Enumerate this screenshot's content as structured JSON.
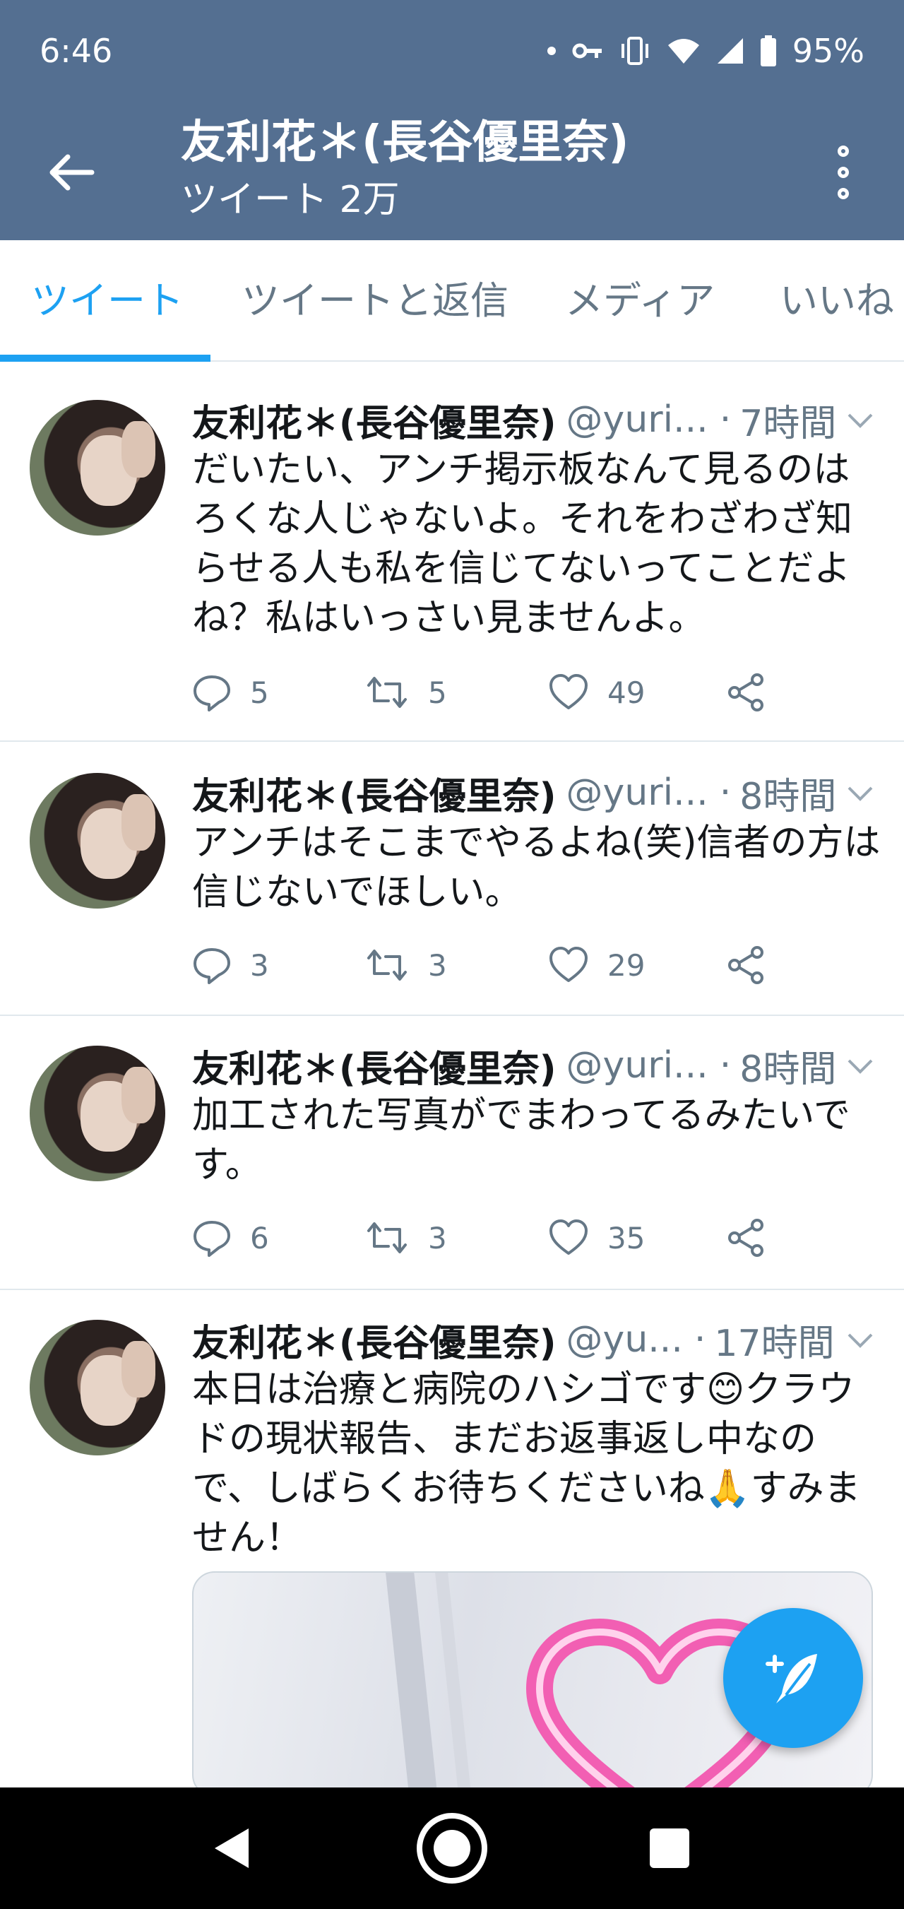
{
  "status_bar": {
    "time": "6:46",
    "battery": "95%",
    "icons": [
      "notification-dot-icon",
      "key-icon",
      "vibrate-icon",
      "wifi-icon",
      "signal-icon",
      "battery-icon"
    ]
  },
  "header": {
    "title": "友利花＊(長谷優里奈)",
    "subtitle": "ツイート 2万",
    "back_icon": "back-arrow-icon",
    "more_icon": "more-vertical-icon"
  },
  "tabs": [
    {
      "label": "ツイート",
      "active": true
    },
    {
      "label": "ツイートと返信",
      "active": false
    },
    {
      "label": "メディア",
      "active": false
    },
    {
      "label": "いいね",
      "active": false
    }
  ],
  "tweets": [
    {
      "name": "友利花＊(長谷優里奈)",
      "handle": "@yuri...",
      "time": "7時間",
      "text": "だいたい、アンチ掲示板なんて見るのはろくな人じゃないよ。それをわざわざ知らせる人も私を信じてないってことだよね？私はいっさい見ませんよ。",
      "replies": "5",
      "retweets": "5",
      "likes": "49"
    },
    {
      "name": "友利花＊(長谷優里奈)",
      "handle": "@yuri...",
      "time": "8時間",
      "text": "アンチはそこまでやるよね(笑)信者の方は信じないでほしい。",
      "replies": "3",
      "retweets": "3",
      "likes": "29"
    },
    {
      "name": "友利花＊(長谷優里奈)",
      "handle": "@yuri...",
      "time": "8時間",
      "text": "加工された写真がでまわってるみたいです。",
      "replies": "6",
      "retweets": "3",
      "likes": "35"
    },
    {
      "name": "友利花＊(長谷優里奈)",
      "handle": "@yu...",
      "time": "17時間",
      "text": "本日は治療と病院のハシゴです😊クラウドの現状報告、まだお返事返し中なので、しばらくお待ちくださいね🙏すみません！"
    }
  ],
  "colors": {
    "header_bg": "#546f91",
    "accent": "#1da1f2",
    "secondary_text": "#657786",
    "divider": "#e1e8ed"
  },
  "fab_icon": "compose-tweet-icon"
}
